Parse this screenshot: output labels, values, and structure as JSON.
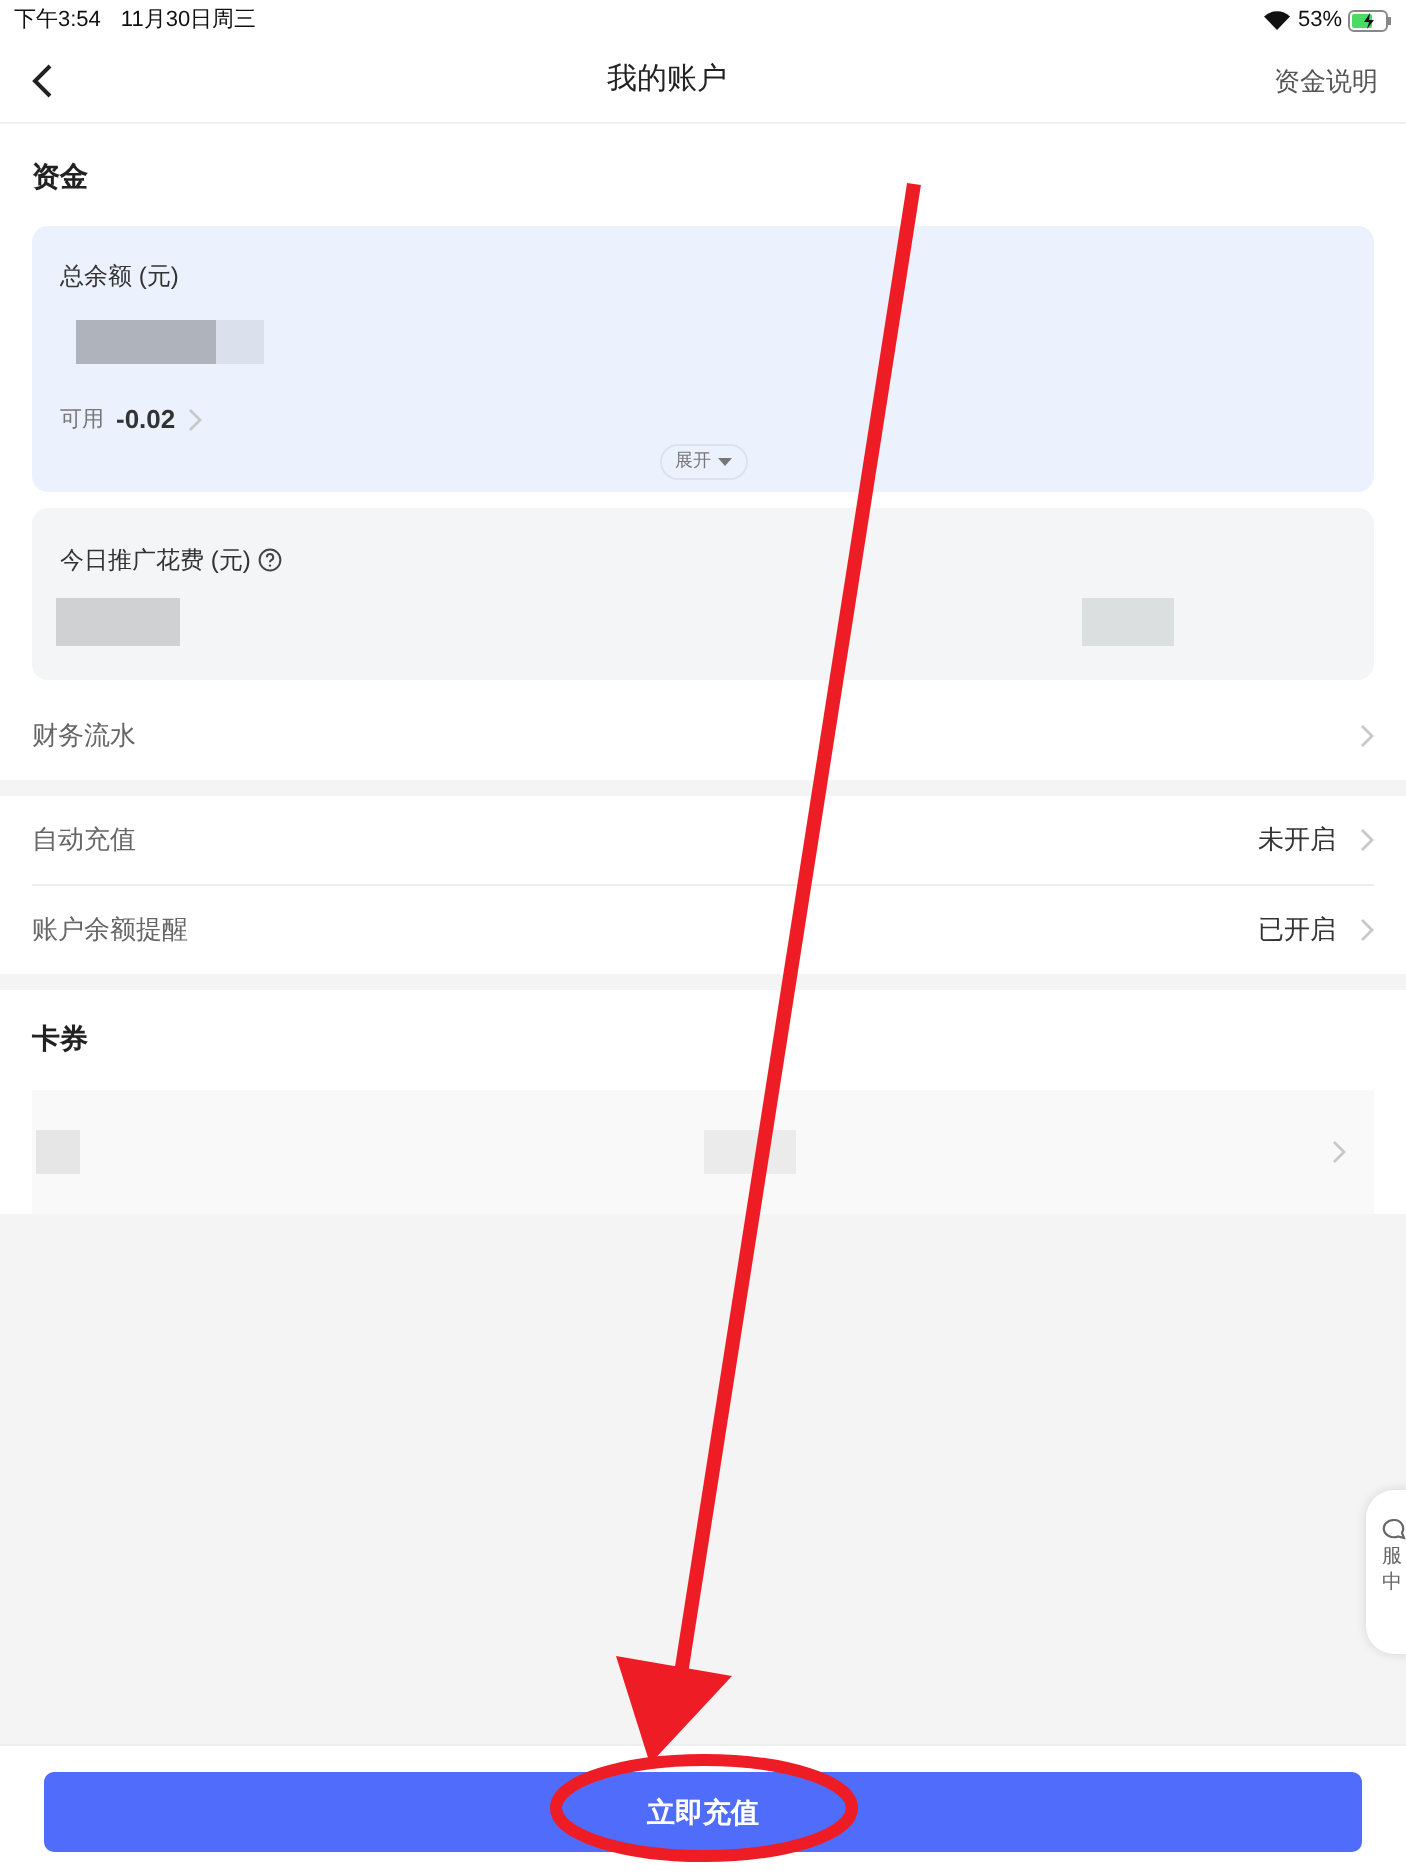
{
  "status_bar": {
    "time": "下午3:54",
    "date": "11月30日周三",
    "battery": "53%"
  },
  "nav": {
    "title": "我的账户",
    "right_link": "资金说明"
  },
  "funds": {
    "title": "资金",
    "balance_label": "总余额 (元)",
    "available_label": "可用",
    "available_value": "-0.02",
    "expand_label": "展开",
    "spend_label": "今日推广花费 (元)"
  },
  "row_groups": [
    [
      {
        "label": "财务流水"
      }
    ],
    [
      {
        "label": "自动充值",
        "value": "未开启"
      },
      {
        "label": "账户余额提醒",
        "value": "已开启"
      }
    ]
  ],
  "coupons": {
    "title": "卡券"
  },
  "service_tab": {
    "text": "服中"
  },
  "bottom_button": {
    "label": "立即充值"
  }
}
